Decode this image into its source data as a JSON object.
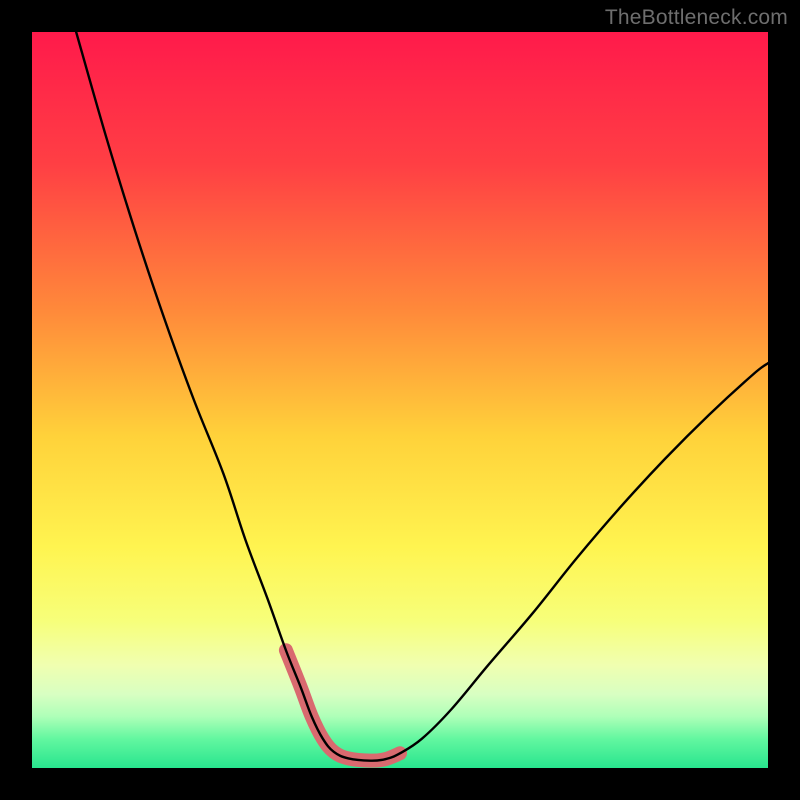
{
  "watermark": "TheBottleneck.com",
  "chart_data": {
    "type": "line",
    "title": "",
    "xlabel": "",
    "ylabel": "",
    "xlim": [
      0,
      100
    ],
    "ylim": [
      0,
      100
    ],
    "gradient_stops": [
      {
        "offset": 0,
        "color": "#ff1a4b"
      },
      {
        "offset": 18,
        "color": "#ff3f44"
      },
      {
        "offset": 38,
        "color": "#ff8a3a"
      },
      {
        "offset": 55,
        "color": "#ffd23a"
      },
      {
        "offset": 70,
        "color": "#fff450"
      },
      {
        "offset": 80,
        "color": "#f7ff7a"
      },
      {
        "offset": 86,
        "color": "#f0ffb0"
      },
      {
        "offset": 90,
        "color": "#d8ffc2"
      },
      {
        "offset": 93,
        "color": "#aeffb8"
      },
      {
        "offset": 96,
        "color": "#63f7a0"
      },
      {
        "offset": 100,
        "color": "#28e58e"
      }
    ],
    "series": [
      {
        "name": "bottleneck-curve",
        "x": [
          6,
          10,
          14,
          18,
          22,
          26,
          29,
          32,
          34.5,
          36.5,
          38,
          39.5,
          41,
          43,
          46,
          48,
          50,
          53,
          57,
          62,
          68,
          74,
          80,
          86,
          92,
          98,
          100
        ],
        "y": [
          100,
          86,
          73,
          61,
          50,
          40,
          31,
          23,
          16,
          11,
          7,
          4,
          2.2,
          1.3,
          1.0,
          1.2,
          2.0,
          4,
          8,
          14,
          21,
          28.5,
          35.5,
          42,
          48,
          53.5,
          55
        ]
      },
      {
        "name": "highlight-band",
        "x": [
          34.5,
          36.5,
          38,
          39.5,
          41,
          43,
          46,
          48,
          50
        ],
        "y": [
          16,
          11,
          7,
          4,
          2.2,
          1.3,
          1.0,
          1.2,
          2.0
        ]
      }
    ]
  }
}
